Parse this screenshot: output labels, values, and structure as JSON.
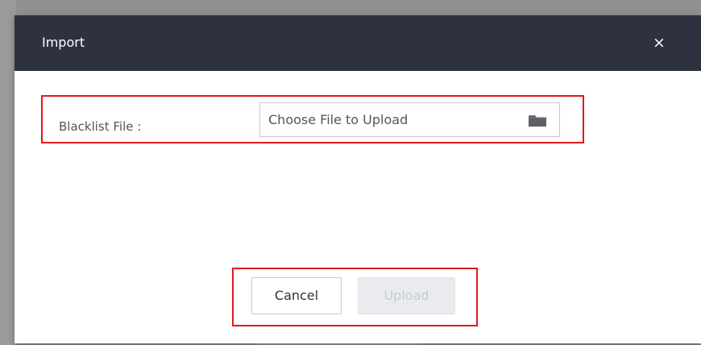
{
  "dialog": {
    "title": "Import",
    "close_label": "×",
    "field": {
      "label": "Blacklist File :",
      "placeholder": "Choose File to Upload",
      "icon": "folder-icon"
    },
    "actions": {
      "cancel_label": "Cancel",
      "upload_label": "Upload",
      "upload_disabled": true
    },
    "colors": {
      "header_bg": "#2e3240",
      "highlight": "#e0191f",
      "disabled_text": "#c7cbd1"
    }
  }
}
